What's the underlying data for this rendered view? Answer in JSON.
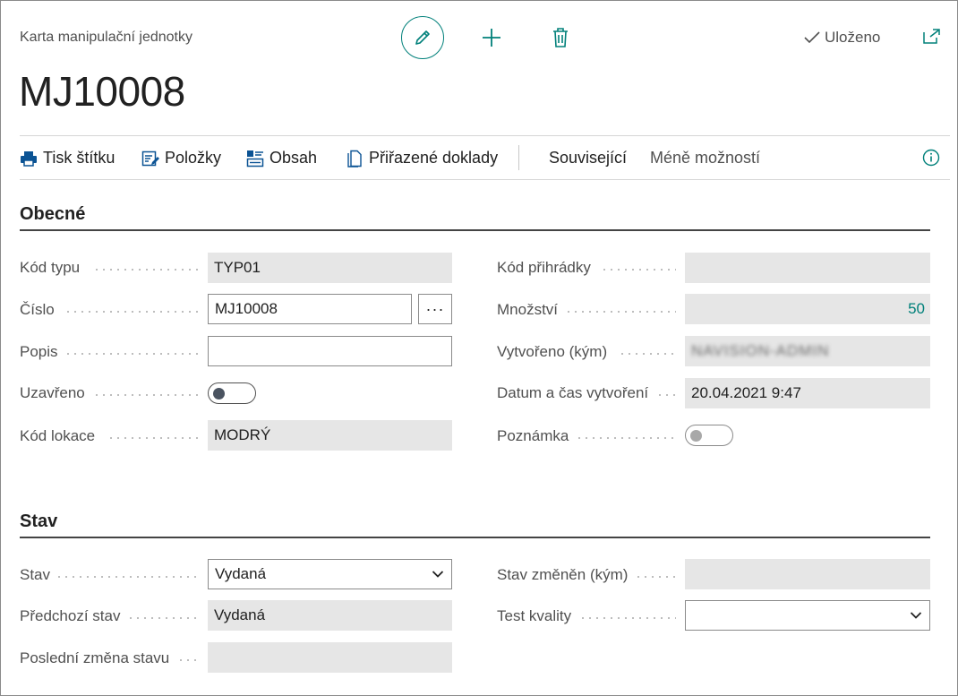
{
  "header": {
    "caption": "Karta manipulační jednotky",
    "title": "MJ10008",
    "saved_label": "Uloženo"
  },
  "actions": {
    "print_label": "Tisk štítku",
    "items_label": "Položky",
    "content_label": "Obsah",
    "assigned_docs_label": "Přiřazené doklady",
    "related_label": "Související",
    "fewer_options_label": "Méně možností"
  },
  "general": {
    "title": "Obecné",
    "type_code": {
      "label": "Kód typu",
      "value": "TYP01"
    },
    "number": {
      "label": "Číslo",
      "value": "MJ10008",
      "assist": "···"
    },
    "description": {
      "label": "Popis",
      "value": ""
    },
    "closed": {
      "label": "Uzavřeno",
      "on": false
    },
    "location_code": {
      "label": "Kód lokace",
      "value": "MODRÝ"
    },
    "bin_code": {
      "label": "Kód přihrádky",
      "value": ""
    },
    "quantity": {
      "label": "Množství",
      "value": "50"
    },
    "created_by": {
      "label": "Vytvořeno (kým)",
      "value": "NAVISION-ADMIN"
    },
    "created_at": {
      "label": "Datum a čas vytvoření",
      "value": "20.04.2021 9:47"
    },
    "note": {
      "label": "Poznámka",
      "on": false
    }
  },
  "status": {
    "title": "Stav",
    "state": {
      "label": "Stav",
      "value": "Vydaná"
    },
    "previous_state": {
      "label": "Předchozí stav",
      "value": "Vydaná"
    },
    "last_change": {
      "label": "Poslední změna stavu",
      "value": ""
    },
    "changed_by": {
      "label": "Stav změněn (kým)",
      "value": ""
    },
    "quality_test": {
      "label": "Test kvality",
      "value": ""
    }
  },
  "colors": {
    "accent": "#00807a",
    "readonly_bg": "#e6e6e6"
  },
  "icons": [
    "edit-icon",
    "plus-icon",
    "trash-icon",
    "check-icon",
    "popout-icon",
    "printer-icon",
    "edit-list-icon",
    "content-icon",
    "document-icon",
    "info-icon",
    "chevron-down-icon"
  ]
}
